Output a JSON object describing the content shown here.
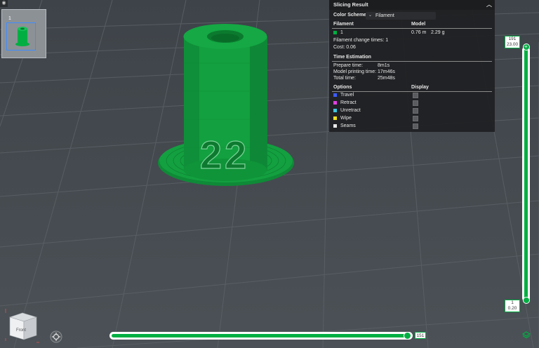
{
  "thumbnail": {
    "number": "1"
  },
  "panel": {
    "title": "Slicing Result",
    "color_scheme_label": "Color Scheme",
    "color_scheme_value": "Filament",
    "filament_header": "Filament",
    "model_header": "Model",
    "filament_index": "1",
    "filament_color": "#00ae42",
    "model_length": "0.76 m",
    "model_weight": "2.29 g",
    "filament_change_times": "Filament change times:  1",
    "cost": "Cost:  0.06",
    "time_header": "Time Estimation",
    "prepare_label": "Prepare time:",
    "prepare_value": "8m1s",
    "model_print_label": "Model printing time:",
    "model_print_value": "17m46s",
    "total_label": "Total time:",
    "total_value": "25m48s",
    "options_header": "Options",
    "display_header": "Display",
    "options": [
      {
        "label": "Travel",
        "color": "#3d5cff"
      },
      {
        "label": "Retract",
        "color": "#e040e0"
      },
      {
        "label": "Unretract",
        "color": "#40c8e0"
      },
      {
        "label": "Wipe",
        "color": "#f0e020"
      },
      {
        "label": "Seams",
        "color": "#e8e8e8"
      }
    ]
  },
  "vslider": {
    "top_layer": "191",
    "top_height": "23.00",
    "bottom_layer": "1",
    "bottom_height": "0.20"
  },
  "hslider": {
    "value": "151"
  },
  "cube_label": "Front",
  "model_text": "22",
  "colors": {
    "accent": "#00ae42",
    "bed": "#444a4f"
  }
}
